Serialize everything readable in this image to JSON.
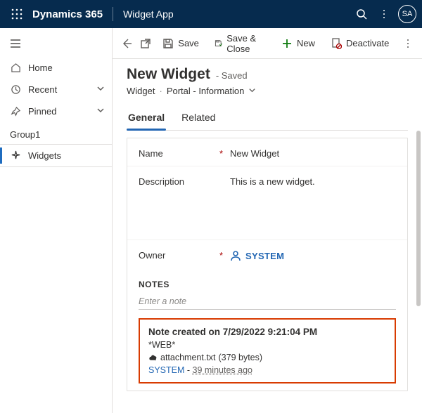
{
  "topbar": {
    "brand": "Dynamics 365",
    "app_name": "Widget App",
    "avatar_initials": "SA"
  },
  "nav": {
    "home": "Home",
    "recent": "Recent",
    "pinned": "Pinned",
    "group_label": "Group1",
    "widgets": "Widgets"
  },
  "cmd": {
    "save": "Save",
    "save_close": "Save & Close",
    "new": "New",
    "deactivate": "Deactivate"
  },
  "header": {
    "title": "New Widget",
    "saved_suffix": "- Saved",
    "entity": "Widget",
    "form": "Portal - Information"
  },
  "tabs": {
    "general": "General",
    "related": "Related"
  },
  "form": {
    "name_label": "Name",
    "name_value": "New Widget",
    "description_label": "Description",
    "description_value": "This is a new widget.",
    "owner_label": "Owner",
    "owner_value": "SYSTEM",
    "notes_label": "NOTES",
    "note_placeholder": "Enter a note"
  },
  "note": {
    "title": "Note created on 7/29/2022 9:21:04 PM",
    "tag": "*WEB*",
    "attachment_name": "attachment.txt",
    "attachment_meta": "(379 bytes)",
    "author": "SYSTEM",
    "footer_sep": " - ",
    "relative_time": "39 minutes ago"
  }
}
